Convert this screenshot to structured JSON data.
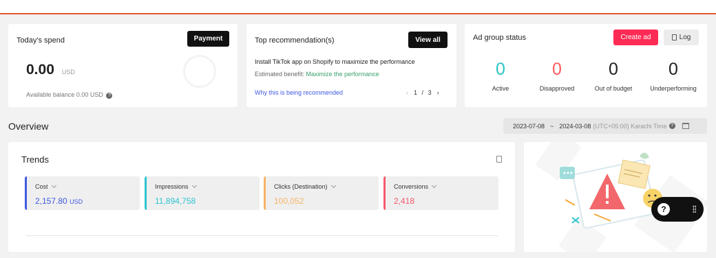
{
  "spend": {
    "title": "Today's spend",
    "payment_label": "Payment",
    "amount": "0.00",
    "currency": "USD",
    "balance": "Available balance 0.00 USD"
  },
  "recommendation": {
    "title": "Top recommendation(s)",
    "view_all_label": "View all",
    "text": "Install TikTok app on Shopify to maximize the performance",
    "benefit_prefix": "Estimated benefit: ",
    "benefit_value": "Maximize the performance",
    "why_link": "Why this is being recommended",
    "page_current": "1",
    "page_sep": "/",
    "page_total": "3"
  },
  "ad_group": {
    "title": "Ad group status",
    "create_label": "Create ad",
    "log_label": "Log",
    "stats": [
      {
        "value": "0",
        "label": "Active",
        "color": "#2ec4c4"
      },
      {
        "value": "0",
        "label": "Disapproved",
        "color": "#fe5c5c"
      },
      {
        "value": "0",
        "label": "Out of budget",
        "color": "#222222"
      },
      {
        "value": "0",
        "label": "Underperforming",
        "color": "#222222"
      }
    ]
  },
  "overview": {
    "title": "Overview",
    "date_start": "2023-07-08",
    "date_sep": "~",
    "date_end": "2024-03-08",
    "timezone": "(UTC+05:00) Karachi Time"
  },
  "trends": {
    "title": "Trends",
    "metrics": [
      {
        "label": "Cost",
        "value": "2,157.80",
        "unit": "USD",
        "color": "#3f5ae0"
      },
      {
        "label": "Impressions",
        "value": "11,894,758",
        "unit": "",
        "color": "#2ec4cf"
      },
      {
        "label": "Clicks (Destination)",
        "value": "100,052",
        "unit": "",
        "color": "#f7b267"
      },
      {
        "label": "Conversions",
        "value": "2,418",
        "unit": "",
        "color": "#f5576c"
      }
    ]
  },
  "colors": {
    "accent": "#fe2c55",
    "top_border": "#e2552a",
    "link": "#3f5ae0",
    "benefit": "#3aa16a"
  }
}
